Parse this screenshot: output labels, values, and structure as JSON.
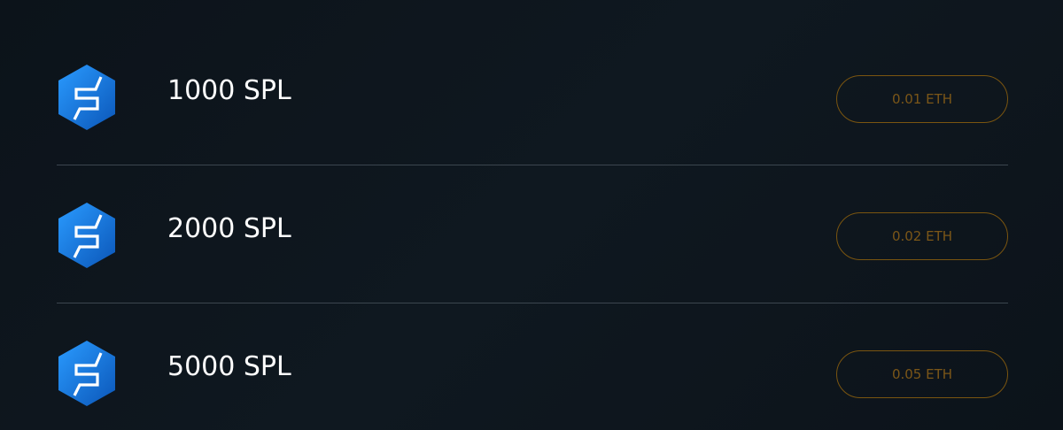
{
  "accent_color": "#b07a1c",
  "logo_color": "#1b7fe0",
  "packages": [
    {
      "icon": "spl-token-logo-icon",
      "amount": "1000 SPL",
      "price": "0.01 ETH"
    },
    {
      "icon": "spl-token-logo-icon",
      "amount": "2000 SPL",
      "price": "0.02 ETH"
    },
    {
      "icon": "spl-token-logo-icon",
      "amount": "5000 SPL",
      "price": "0.05 ETH"
    }
  ]
}
